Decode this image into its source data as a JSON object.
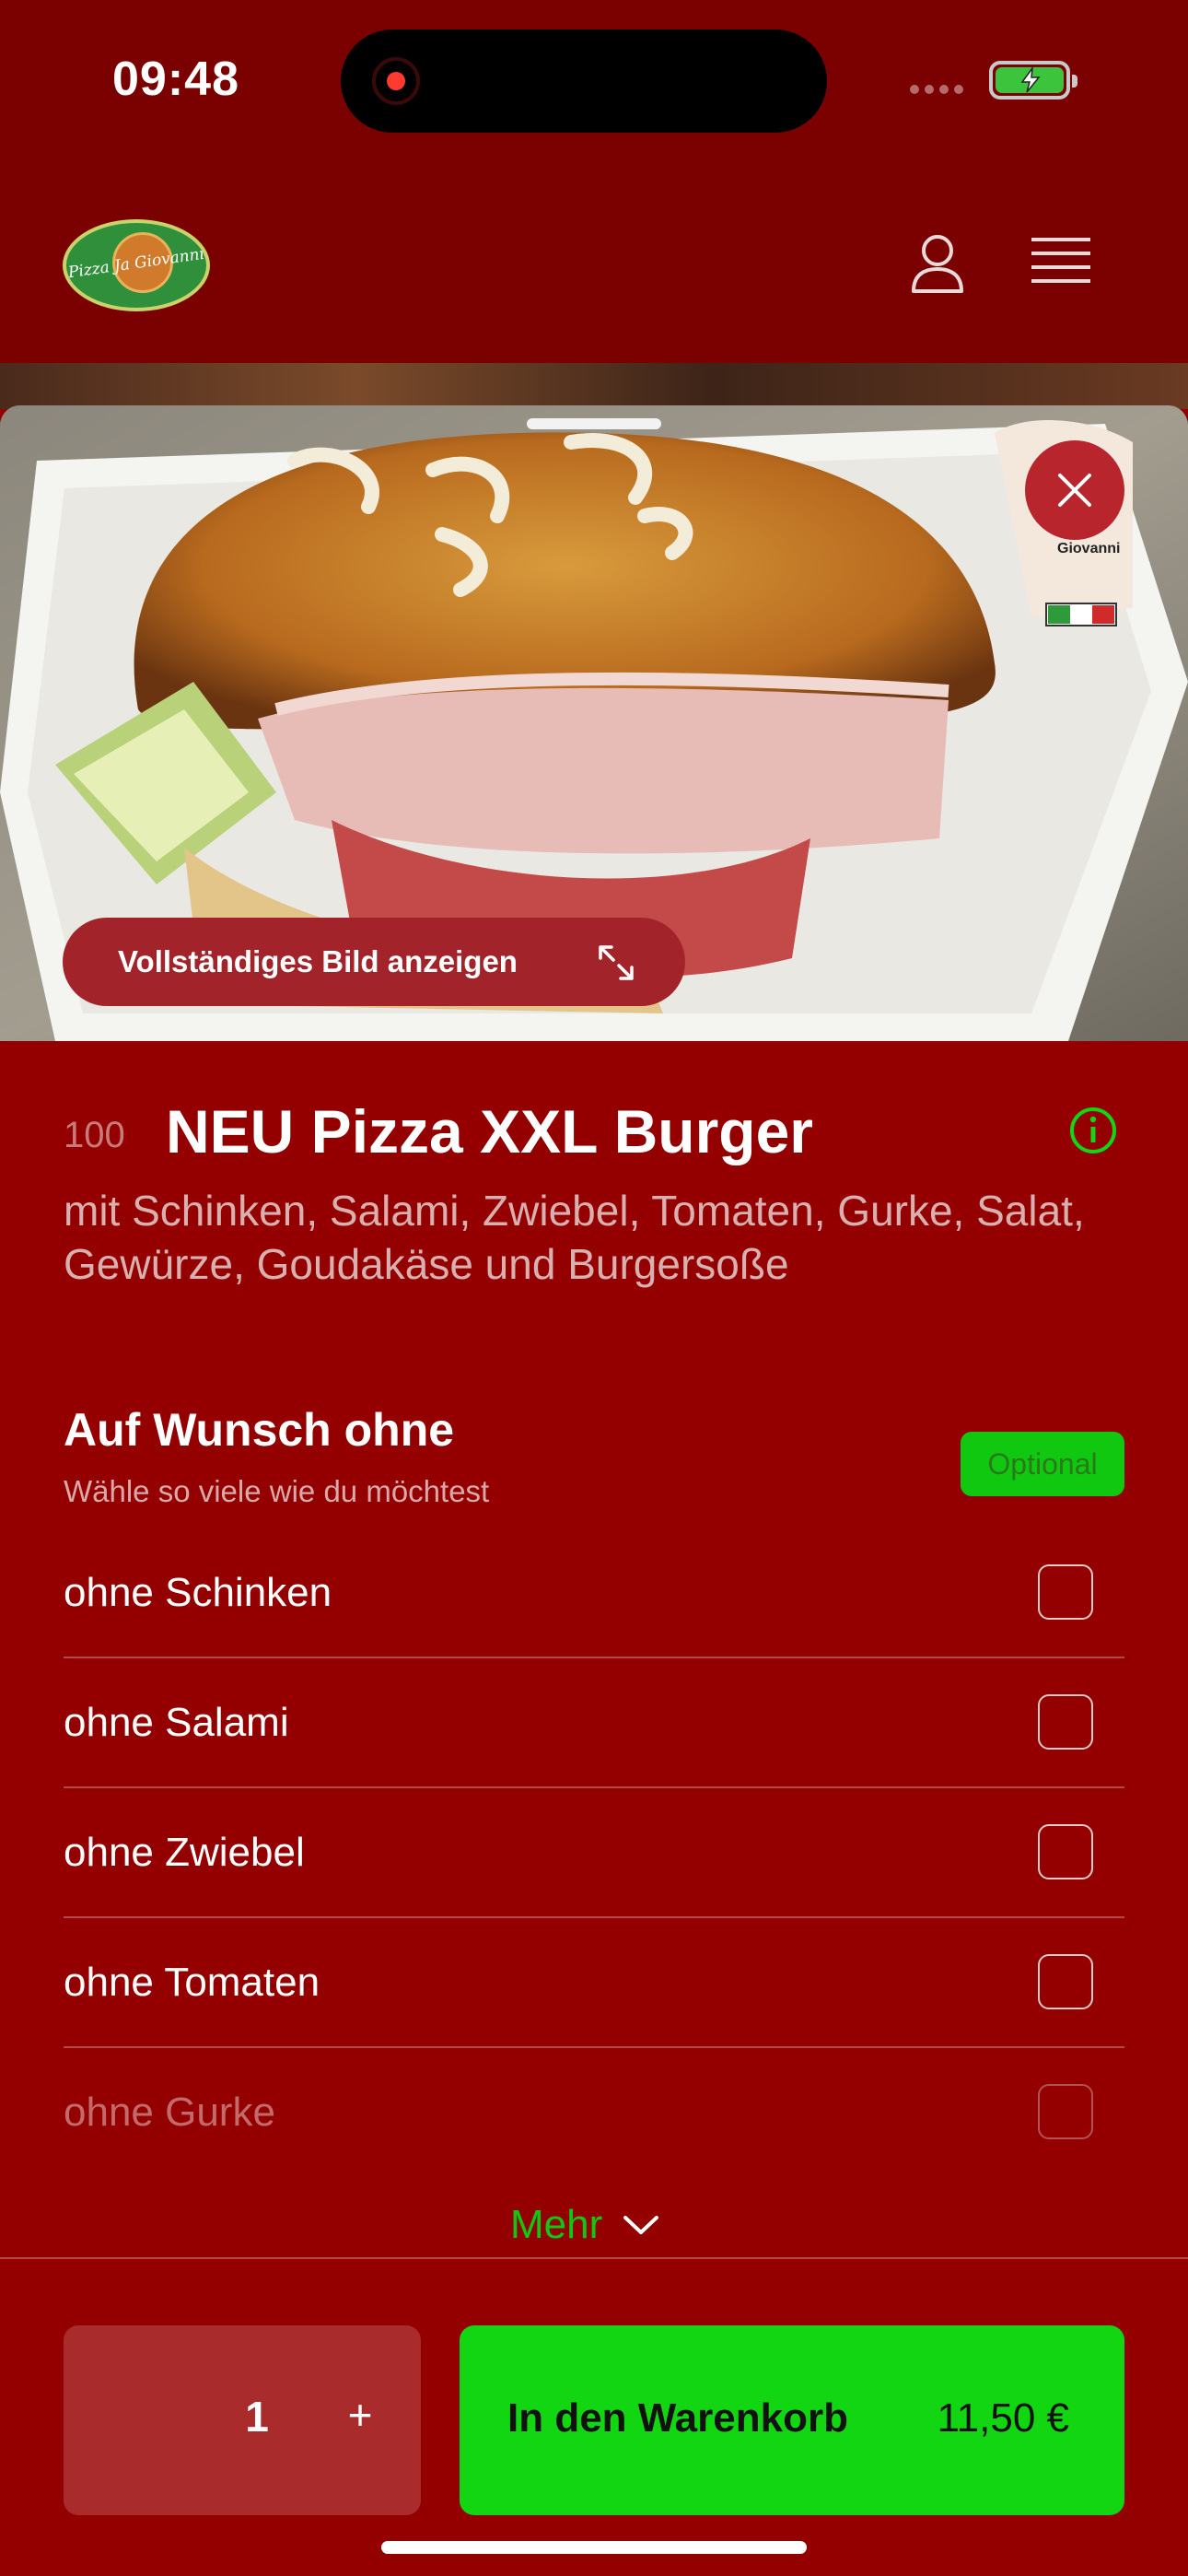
{
  "status_bar": {
    "time": "09:48"
  },
  "header": {
    "logo_text": "Pizza Ja Giovanni"
  },
  "hero": {
    "full_image_label": "Vollständiges Bild anzeigen"
  },
  "product": {
    "number": "100",
    "title": "NEU Pizza XXL Burger",
    "description": "mit Schinken, Salami, Zwiebel, Tomaten, Gurke, Salat, Gewürze, Goudakäse und Burgersoße"
  },
  "options_section": {
    "title": "Auf Wunsch ohne",
    "subtitle": "Wähle so viele wie du möchtest",
    "badge": "Optional",
    "items": [
      {
        "label": "ohne Schinken",
        "checked": false
      },
      {
        "label": "ohne Salami",
        "checked": false
      },
      {
        "label": "ohne Zwiebel",
        "checked": false
      },
      {
        "label": "ohne Tomaten",
        "checked": false
      },
      {
        "label": "ohne Gurke",
        "checked": false
      }
    ],
    "more_label": "Mehr"
  },
  "bottom_bar": {
    "quantity": "1",
    "plus": "+",
    "cart_label": "In den Warenkorb",
    "price": "11,50 €"
  },
  "colors": {
    "background": "#940000",
    "header": "#7b0000",
    "accent_green": "#11d611",
    "close_button": "#b8252d"
  }
}
